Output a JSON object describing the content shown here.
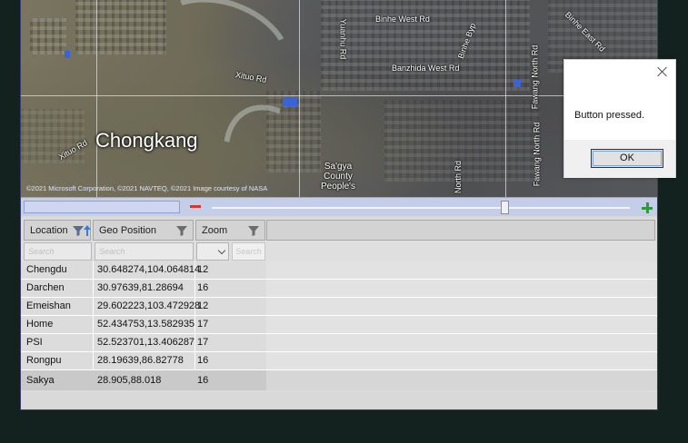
{
  "map": {
    "city_label": "Chongkang",
    "county_label_lines": [
      "Sa'gya",
      "County",
      "People's"
    ],
    "roads": {
      "binhe_west": "Binhe West Rd",
      "binhe_byp": "Binhe Byp",
      "binhe_east": "Binhe East Rd",
      "banzhida_west": "Banzhida West Rd",
      "xituo_1": "Xituo Rd",
      "xituo_2": "Xituo Rd",
      "yuanhu": "Yuanhu Rd",
      "fawang_north": "Fawang North Rd",
      "north_rd": "North Rd"
    },
    "copyright": "©2021 Microsoft Corporation, ©2021 NAVTEQ, ©2021 Image courtesy of NASA"
  },
  "zoom": {
    "level_fraction": 0.7
  },
  "grid": {
    "columns": [
      {
        "label": "Location",
        "filter_icon": "filter-icon",
        "sort_icon": "sort-ascending-icon"
      },
      {
        "label": "Geo Position",
        "filter_icon": "filter-icon"
      },
      {
        "label": "Zoom",
        "filter_icon": "filter-icon"
      }
    ],
    "filter_row": {
      "location_placeholder": "Search",
      "geo_placeholder": "Search",
      "search_button": "Search"
    },
    "rows": [
      {
        "location": "Chengdu",
        "geo": "30.648274,104.064814",
        "zoom": "12"
      },
      {
        "location": "Darchen",
        "geo": "30.97639,81.28694",
        "zoom": "16"
      },
      {
        "location": "Emeishan",
        "geo": "29.602223,103.472928",
        "zoom": "12"
      },
      {
        "location": "Home",
        "geo": "52.434753,13.582935",
        "zoom": "17"
      },
      {
        "location": "PSI",
        "geo": "52.523701,13.406287",
        "zoom": "17"
      },
      {
        "location": "Rongpu",
        "geo": "28.19639,86.82778",
        "zoom": "16"
      },
      {
        "location": "Sakya",
        "geo": "28.905,88.018",
        "zoom": "16"
      }
    ]
  },
  "dialog": {
    "message": "Button pressed.",
    "ok_label": "OK",
    "close_icon": "close-icon"
  },
  "colors": {
    "zoom_minus": "#d13a2c",
    "zoom_plus": "#2e9b3a",
    "zoom_bar": "#c5cee8",
    "background": "#14221f"
  }
}
